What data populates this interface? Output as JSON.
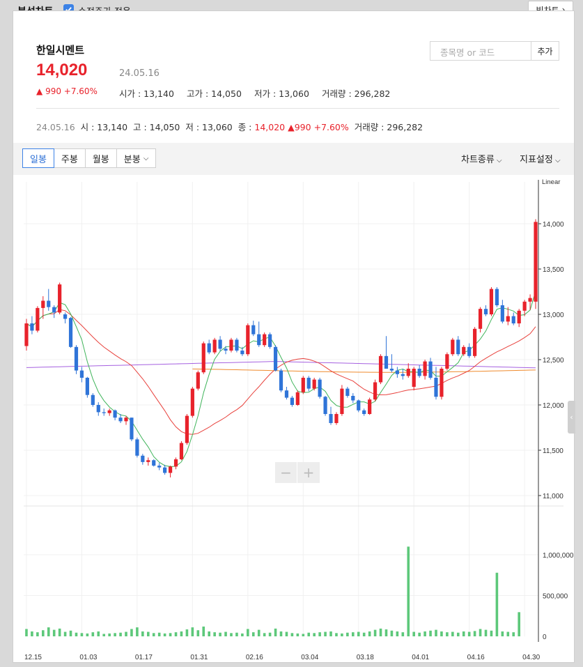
{
  "header": {
    "title": "분석차트",
    "adjusted_price_label": "수정주가 적용",
    "big_chart_label": "빅차트"
  },
  "stock": {
    "name": "한일시멘트",
    "price": "14,020",
    "date": "24.05.16",
    "change": "990 +7.60%",
    "open_label": "시가 : 13,140",
    "high_label": "고가 : 14,050",
    "low_label": "저가 : 13,060",
    "volume_label": "거래량 : 296,282"
  },
  "search": {
    "placeholder": "종목명 or 코드",
    "add_label": "추가"
  },
  "summary": {
    "date": "24.05.16",
    "open": "시 : 13,140",
    "high": "고 : 14,050",
    "low": "저 : 13,060",
    "close_label": "종 : ",
    "close_value": "14,020",
    "change": "990 +7.60%",
    "volume": "거래량 : 296,282"
  },
  "toolbar": {
    "tabs": [
      "일봉",
      "주봉",
      "월봉",
      "분봉"
    ],
    "active_tab": "일봉",
    "chart_type_label": "차트종류",
    "indicator_label": "지표설정"
  },
  "colors": {
    "up": "#e8222b",
    "down": "#2f74d8",
    "volume": "#5dc87a",
    "ma5": "#3fb45a",
    "ma20": "#e8413c",
    "ma60": "#ef8a2c",
    "ma120": "#a560e0"
  },
  "chart_data": {
    "type": "candlestick",
    "scale_label": "Linear",
    "price_ylim": [
      11000,
      14100
    ],
    "price_ticks": [
      "14,000",
      "13,500",
      "13,000",
      "12,500",
      "12,000",
      "11,500",
      "11,000"
    ],
    "volume_ticks": [
      "1,000,000",
      "500,000",
      "0"
    ],
    "x_labels": [
      "12.15",
      "01.03",
      "01.17",
      "01.31",
      "02.16",
      "03.04",
      "03.18",
      "04.01",
      "04.16",
      "04.30"
    ],
    "x_label_index": [
      0,
      10,
      20,
      30,
      40,
      50,
      60,
      70,
      80,
      90
    ],
    "ohlc": [
      [
        12650,
        12950,
        12600,
        12900
      ],
      [
        12900,
        12980,
        12780,
        12820
      ],
      [
        12820,
        13090,
        12800,
        13070
      ],
      [
        13070,
        13200,
        12950,
        13150
      ],
      [
        13150,
        13280,
        13040,
        13080
      ],
      [
        13080,
        13100,
        12960,
        13020
      ],
      [
        13020,
        13350,
        13000,
        13330
      ],
      [
        13000,
        13020,
        12900,
        12950
      ],
      [
        12960,
        12970,
        12630,
        12640
      ],
      [
        12640,
        12660,
        12340,
        12380
      ],
      [
        12380,
        12420,
        12250,
        12300
      ],
      [
        12300,
        12310,
        12080,
        12110
      ],
      [
        12110,
        12130,
        11980,
        12000
      ],
      [
        12000,
        12030,
        11880,
        11920
      ],
      [
        11920,
        11960,
        11880,
        11910
      ],
      [
        11910,
        11960,
        11880,
        11940
      ],
      [
        11940,
        11950,
        11830,
        11860
      ],
      [
        11860,
        11900,
        11800,
        11820
      ],
      [
        11820,
        11880,
        11780,
        11860
      ],
      [
        11860,
        11860,
        11600,
        11620
      ],
      [
        11620,
        11640,
        11420,
        11440
      ],
      [
        11440,
        11460,
        11340,
        11370
      ],
      [
        11370,
        11420,
        11330,
        11390
      ],
      [
        11390,
        11400,
        11320,
        11330
      ],
      [
        11330,
        11360,
        11280,
        11310
      ],
      [
        11310,
        11340,
        11230,
        11250
      ],
      [
        11250,
        11330,
        11200,
        11320
      ],
      [
        11320,
        11420,
        11290,
        11400
      ],
      [
        11400,
        11600,
        11390,
        11580
      ],
      [
        11580,
        11900,
        11560,
        11880
      ],
      [
        11880,
        12200,
        11860,
        12180
      ],
      [
        12180,
        12380,
        12160,
        12360
      ],
      [
        12360,
        12700,
        12340,
        12680
      ],
      [
        12680,
        12720,
        12560,
        12580
      ],
      [
        12580,
        12740,
        12560,
        12720
      ],
      [
        12720,
        12760,
        12590,
        12620
      ],
      [
        12620,
        12650,
        12560,
        12600
      ],
      [
        12600,
        12740,
        12580,
        12720
      ],
      [
        12720,
        12740,
        12580,
        12600
      ],
      [
        12600,
        12640,
        12540,
        12560
      ],
      [
        12560,
        12900,
        12540,
        12880
      ],
      [
        12880,
        12930,
        12760,
        12780
      ],
      [
        12780,
        12920,
        12640,
        12660
      ],
      [
        12660,
        12800,
        12640,
        12780
      ],
      [
        12780,
        12800,
        12620,
        12640
      ],
      [
        12640,
        12660,
        12370,
        12380
      ],
      [
        12380,
        12400,
        12140,
        12160
      ],
      [
        12160,
        12200,
        12060,
        12080
      ],
      [
        12080,
        12100,
        11980,
        12000
      ],
      [
        12000,
        12160,
        11990,
        12140
      ],
      [
        12140,
        12320,
        12120,
        12300
      ],
      [
        12300,
        12320,
        12150,
        12180
      ],
      [
        12180,
        12300,
        12160,
        12280
      ],
      [
        12280,
        12300,
        12070,
        12090
      ],
      [
        12090,
        12100,
        11880,
        11900
      ],
      [
        11900,
        11980,
        11780,
        11800
      ],
      [
        11800,
        11920,
        11780,
        11900
      ],
      [
        11900,
        12220,
        11880,
        12180
      ],
      [
        12180,
        12200,
        12080,
        12100
      ],
      [
        12100,
        12130,
        12020,
        12050
      ],
      [
        12050,
        12060,
        11920,
        11940
      ],
      [
        11940,
        11960,
        11880,
        11900
      ],
      [
        11900,
        12080,
        11890,
        12060
      ],
      [
        12060,
        12280,
        12040,
        12250
      ],
      [
        12250,
        12560,
        12230,
        12540
      ],
      [
        12540,
        12760,
        12480,
        12400
      ],
      [
        12400,
        12560,
        12360,
        12380
      ],
      [
        12380,
        12420,
        12300,
        12340
      ],
      [
        12340,
        12400,
        12280,
        12320
      ],
      [
        12320,
        12460,
        12300,
        12400
      ],
      [
        12200,
        12420,
        12160,
        12400
      ],
      [
        12400,
        12440,
        12300,
        12320
      ],
      [
        12320,
        12500,
        12280,
        12480
      ],
      [
        12480,
        12520,
        12280,
        12300
      ],
      [
        12300,
        12420,
        12060,
        12090
      ],
      [
        12090,
        12420,
        12060,
        12400
      ],
      [
        12400,
        12580,
        12380,
        12560
      ],
      [
        12560,
        12740,
        12540,
        12720
      ],
      [
        12720,
        12760,
        12540,
        12560
      ],
      [
        12560,
        12660,
        12540,
        12640
      ],
      [
        12640,
        12680,
        12520,
        12540
      ],
      [
        12540,
        12860,
        12520,
        12840
      ],
      [
        12840,
        13080,
        12800,
        13060
      ],
      [
        13060,
        13100,
        12980,
        13000
      ],
      [
        13000,
        13300,
        12980,
        13280
      ],
      [
        13280,
        13300,
        13080,
        13100
      ],
      [
        13100,
        13160,
        12900,
        12920
      ],
      [
        12920,
        13080,
        12880,
        12980
      ],
      [
        12980,
        13020,
        12880,
        12900
      ],
      [
        12900,
        13060,
        12860,
        13040
      ],
      [
        13040,
        13160,
        12980,
        13140
      ],
      [
        13140,
        13220,
        13050,
        13180
      ],
      [
        13140,
        14050,
        13060,
        14020
      ]
    ],
    "volume": [
      90000,
      60000,
      50000,
      75000,
      110000,
      80000,
      95000,
      55000,
      70000,
      45000,
      40000,
      35000,
      50000,
      60000,
      30000,
      35000,
      40000,
      45000,
      55000,
      90000,
      110000,
      60000,
      55000,
      40000,
      45000,
      35000,
      40000,
      50000,
      60000,
      85000,
      110000,
      75000,
      120000,
      60000,
      50000,
      45000,
      55000,
      40000,
      45000,
      35000,
      90000,
      50000,
      80000,
      40000,
      45000,
      95000,
      60000,
      55000,
      40000,
      35000,
      30000,
      45000,
      40000,
      50000,
      55000,
      60000,
      40000,
      35000,
      45000,
      50000,
      55000,
      45000,
      60000,
      80000,
      95000,
      85000,
      70000,
      60000,
      50000,
      1100000,
      55000,
      45000,
      60000,
      70000,
      80000,
      60000,
      50000,
      55000,
      45000,
      60000,
      55000,
      65000,
      90000,
      80000,
      70000,
      780000,
      60000,
      55000,
      50000,
      296282
    ]
  }
}
